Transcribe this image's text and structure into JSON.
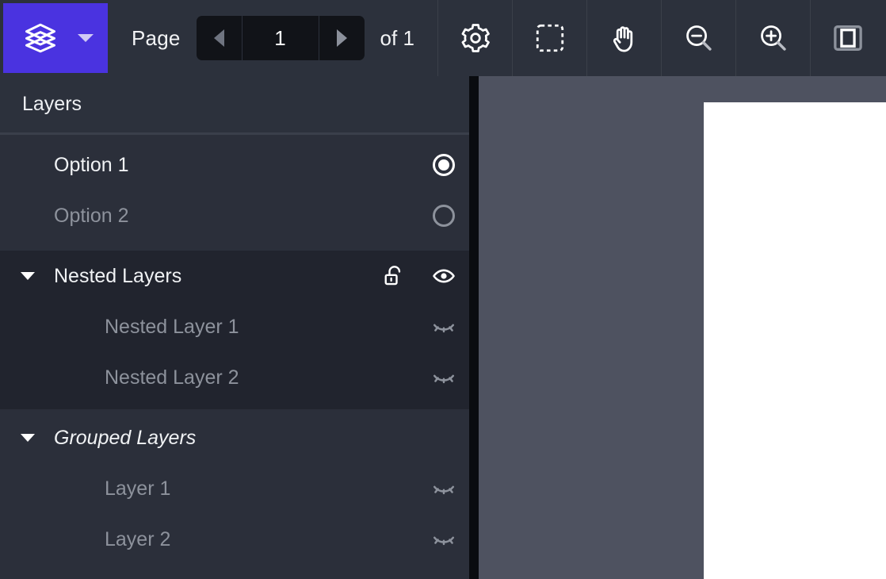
{
  "toolbar": {
    "layers_toggle": {
      "icon": "layers-stack-icon",
      "caret_icon": "chevron-down-icon"
    },
    "page_label": "Page",
    "page_value": "1",
    "page_placeholder": "1",
    "of_label": "of 1",
    "prev_icon": "triangle-left-icon",
    "next_icon": "triangle-right-icon",
    "buttons": [
      {
        "name": "settings-button",
        "icon": "gear-icon"
      },
      {
        "name": "marquee-select-button",
        "icon": "dashed-rectangle-icon"
      },
      {
        "name": "pan-button",
        "icon": "hand-icon"
      },
      {
        "name": "zoom-out-button",
        "icon": "magnifier-minus-icon"
      },
      {
        "name": "zoom-in-button",
        "icon": "magnifier-plus-icon"
      },
      {
        "name": "page-layout-button",
        "icon": "page-panel-icon"
      }
    ]
  },
  "layers_panel": {
    "title": "Layers",
    "sections": [
      {
        "rows": [
          {
            "label": "Option 1",
            "control": "radio-on",
            "muted": false,
            "italic": false
          },
          {
            "label": "Option 2",
            "control": "radio-off",
            "muted": true,
            "italic": false
          }
        ]
      },
      {
        "rows": [
          {
            "label": "Nested Layers",
            "control": "lock-eye",
            "muted": false,
            "italic": false,
            "disclosure": true
          },
          {
            "label": "Nested Layer 1",
            "control": "eye-off",
            "muted": true,
            "italic": false,
            "child": true
          },
          {
            "label": "Nested Layer 2",
            "control": "eye-off",
            "muted": true,
            "italic": false,
            "child": true
          }
        ]
      },
      {
        "rows": [
          {
            "label": "Grouped Layers",
            "control": "none",
            "muted": false,
            "italic": true,
            "disclosure": true
          },
          {
            "label": "Layer 1",
            "control": "eye-off",
            "muted": true,
            "italic": false,
            "child": true
          },
          {
            "label": "Layer 2",
            "control": "eye-off",
            "muted": true,
            "italic": false,
            "child": true
          }
        ]
      }
    ],
    "icons": {
      "unlock": "unlock-icon",
      "eye": "eye-icon",
      "eye_off": "eye-off-icon",
      "disclosure": "disclosure-triangle-down-icon"
    }
  },
  "canvas": {
    "page_sheet": "document-page",
    "background_color": "#4e5260",
    "sheet_color": "#ffffff"
  },
  "colors": {
    "accent": "#4a33e0",
    "toolbar_bg": "#2c313c",
    "panel_bg": "#2b2f3a",
    "panel_section_dark": "#21242e",
    "text": "#f0f2f4",
    "text_muted": "#8d929c"
  }
}
